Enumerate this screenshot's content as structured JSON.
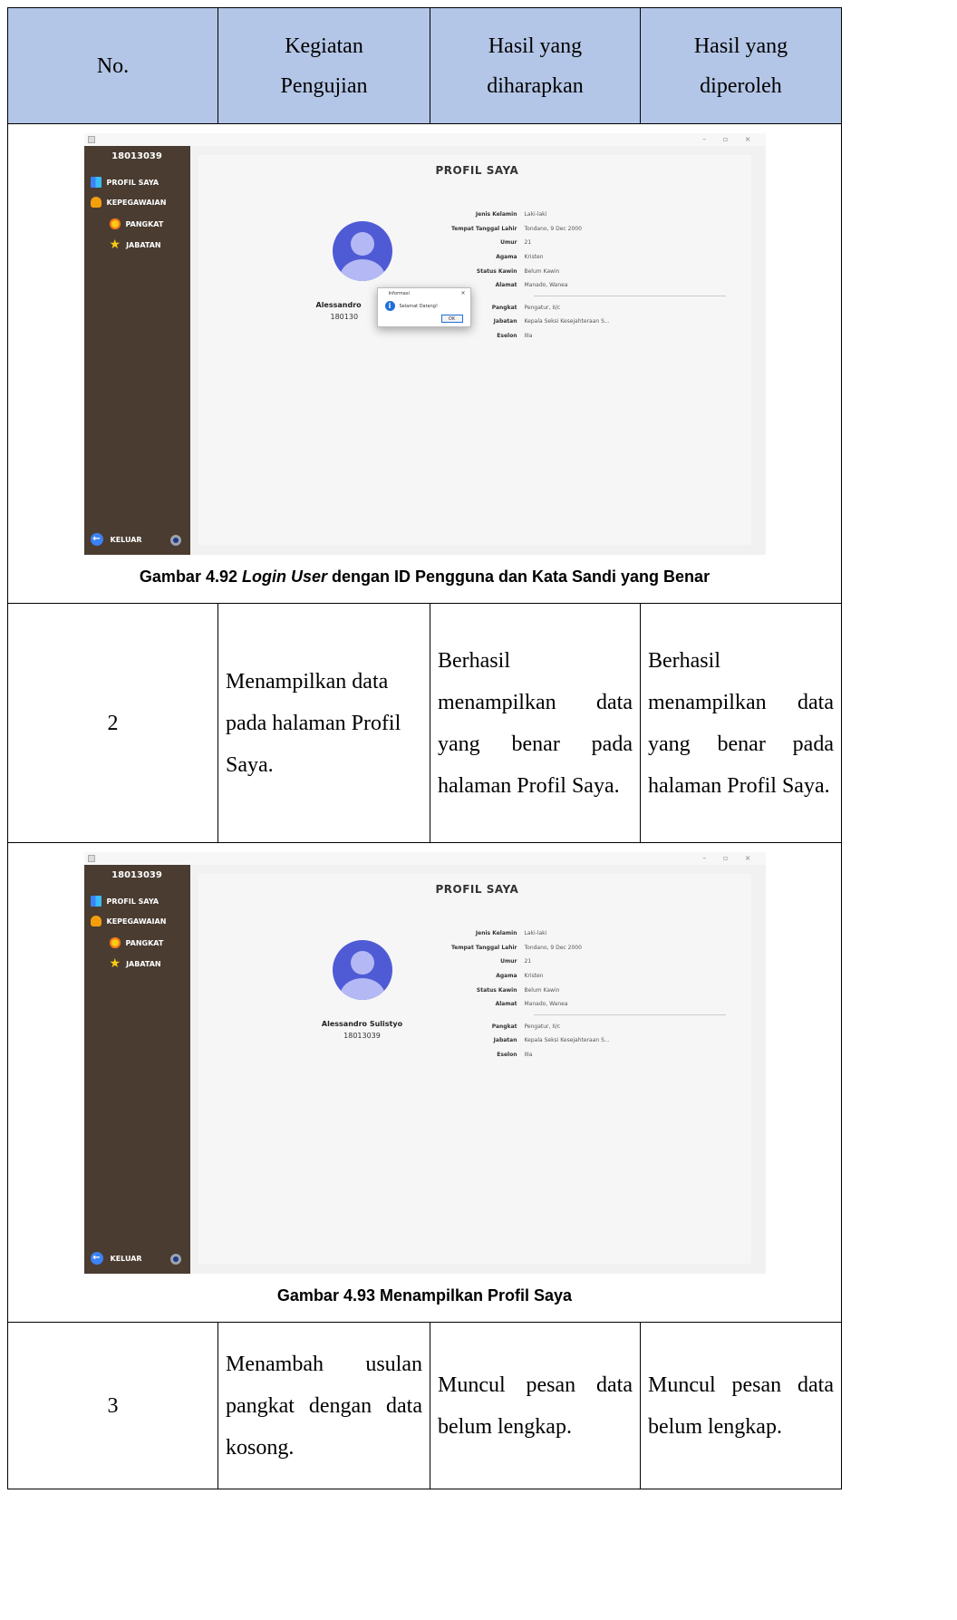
{
  "header": {
    "no": "No.",
    "kegiatan": "Kegiatan Pengujian",
    "harapan": "Hasil yang diharapkan",
    "diperoleh": "Hasil yang diperoleh"
  },
  "figures": [
    {
      "caption_prefix": "Gambar 4.92 ",
      "caption_italic": "Login User",
      "caption_suffix": " dengan ID Pengguna dan Kata Sandi yang Benar",
      "app": {
        "window_controls": "– ▫ ×",
        "sidebar_user_id": "18013039",
        "menu": [
          "PROFIL SAYA",
          "KEPEGAWAIAN",
          "PANGKAT",
          "JABATAN"
        ],
        "logout": "KELUAR",
        "page_title": "PROFIL SAYA",
        "name": "Alessandro",
        "id": "180130",
        "fields": [
          {
            "k": "Jenis Kelamin",
            "v": "Laki-laki"
          },
          {
            "k": "Tempat Tanggal Lahir",
            "v": "Tondano, 9 Dec 2000"
          },
          {
            "k": "Umur",
            "v": "21"
          },
          {
            "k": "Agama",
            "v": "Kristen"
          },
          {
            "k": "Status Kawin",
            "v": "Belum Kawin"
          },
          {
            "k": "Alamat",
            "v": "Manado, Wanea"
          }
        ],
        "fields2": [
          {
            "k": "Pangkat",
            "v": "Pengatur, II/c"
          },
          {
            "k": "Jabatan",
            "v": "Kepala Seksi Kesejahteraan S..."
          },
          {
            "k": "Eselon",
            "v": "IIIa"
          }
        ],
        "dialog": {
          "title": "Informasi",
          "close": "×",
          "message": "Selamat Datang!",
          "ok": "OK",
          "info_glyph": "i"
        }
      }
    },
    {
      "caption_prefix": "Gambar 4.93 Menampilkan Profil Saya",
      "caption_italic": "",
      "caption_suffix": "",
      "app": {
        "window_controls": "– ▫ ×",
        "sidebar_user_id": "18013039",
        "menu": [
          "PROFIL SAYA",
          "KEPEGAWAIAN",
          "PANGKAT",
          "JABATAN"
        ],
        "logout": "KELUAR",
        "page_title": "PROFIL SAYA",
        "name": "Alessandro Sulistyo",
        "id": "18013039",
        "fields": [
          {
            "k": "Jenis Kelamin",
            "v": "Laki-laki"
          },
          {
            "k": "Tempat Tanggal Lahir",
            "v": "Tondano, 9 Dec 2000"
          },
          {
            "k": "Umur",
            "v": "21"
          },
          {
            "k": "Agama",
            "v": "Kristen"
          },
          {
            "k": "Status Kawin",
            "v": "Belum Kawin"
          },
          {
            "k": "Alamat",
            "v": "Manado, Wanea"
          }
        ],
        "fields2": [
          {
            "k": "Pangkat",
            "v": "Pengatur, II/c"
          },
          {
            "k": "Jabatan",
            "v": "Kepala Seksi Kesejahteraan S..."
          },
          {
            "k": "Eselon",
            "v": "IIIa"
          }
        ]
      }
    }
  ],
  "rows": [
    {
      "no": "2",
      "kegiatan": "Menampilkan data pada halaman Profil Saya.",
      "harapan": "Berhasil menampilkan data yang benar pada halaman Profil Saya.",
      "diperoleh": "Berhasil menampilkan data yang benar pada halaman Profil Saya."
    },
    {
      "no": "3",
      "kegiatan": "Menambah usulan pangkat dengan data kosong.",
      "harapan": "Muncul pesan data belum lengkap.",
      "diperoleh": "Muncul pesan data belum lengkap."
    }
  ],
  "colors": {
    "header_bg": "#b4c6e7",
    "sidebar_bg": "#4a3c31",
    "avatar": "#4f5bd5"
  }
}
